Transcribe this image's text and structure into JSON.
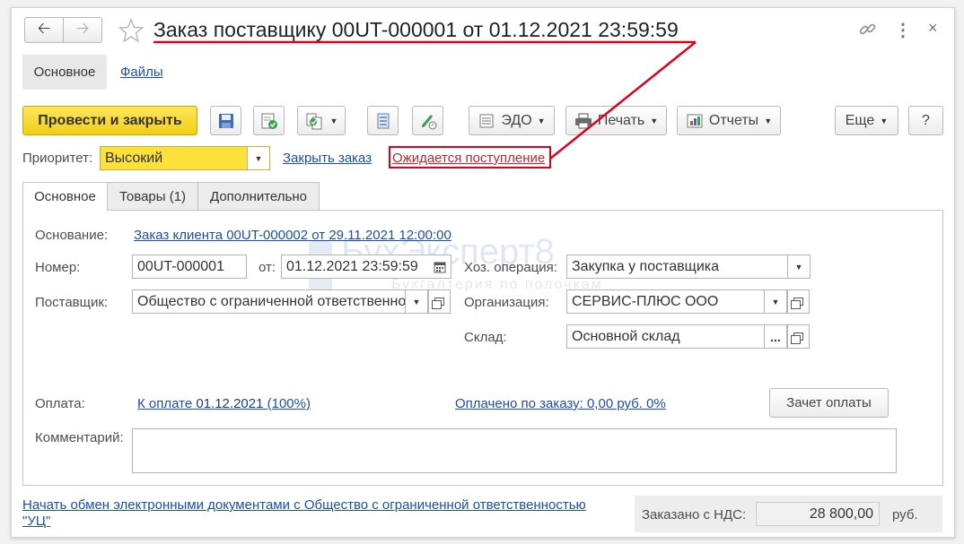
{
  "window": {
    "title": "Заказ поставщику 00UT-000001 от 01.12.2021 23:59:59",
    "nav_tabs": [
      "Основное",
      "Файлы"
    ]
  },
  "toolbar": {
    "post_close": "Провести и закрыть",
    "edo": "ЭДО",
    "print": "Печать",
    "reports": "Отчеты",
    "more": "Еще",
    "help": "?"
  },
  "priority": {
    "label": "Приоритет:",
    "value": "Высокий",
    "close_order": "Закрыть заказ",
    "status": "Ожидается поступление"
  },
  "tabs": [
    "Основное",
    "Товары (1)",
    "Дополнительно"
  ],
  "form": {
    "basis_label": "Основание:",
    "basis_link": "Заказ клиента 00UT-000002 от 29.11.2021 12:00:00",
    "number_label": "Номер:",
    "number_value": "00UT-000001",
    "date_label": "от:",
    "date_value": "01.12.2021 23:59:59",
    "operation_label": "Хоз. операция:",
    "operation_value": "Закупка у поставщика",
    "supplier_label": "Поставщик:",
    "supplier_value": "Общество с ограниченной ответственностью",
    "org_label": "Организация:",
    "org_value": "СЕРВИС-ПЛЮС ООО",
    "warehouse_label": "Склад:",
    "warehouse_value": "Основной склад",
    "warehouse_btn": "...",
    "payment_label": "Оплата:",
    "payment_link_prefix": "К оплате",
    "payment_link_date": "01.12.2021",
    "payment_link_suffix": "(100%)",
    "paid_link": "Оплачено по заказу: 0,00 руб. 0%",
    "offset_btn": "Зачет оплаты",
    "comment_label": "Комментарий:",
    "comment_value": ""
  },
  "footer": {
    "edo_link_line1": "Начать обмен электронными документами с Общество с ограниченной ответственностью",
    "edo_link_line2": "\"УЦ\"",
    "total_label": "Заказано с НДС:",
    "total_value": "28 800,00",
    "currency": "руб."
  },
  "watermark": {
    "name": "БухЭксперт8",
    "tagline": "Бухгалтерия по полочкам"
  },
  "colors": {
    "primary_button": "#f5d423",
    "priority_field": "#fbe13a",
    "link": "#1a4fb0",
    "annotation": "#e0001a"
  },
  "icons": [
    "back-arrow-icon",
    "forward-arrow-icon",
    "star-icon",
    "link-icon",
    "more-vertical-icon",
    "close-icon",
    "save-icon",
    "post-icon",
    "create-based-on-icon",
    "list-icon",
    "edit-signature-icon",
    "edo-icon",
    "printer-icon",
    "reports-icon",
    "calendar-icon"
  ]
}
